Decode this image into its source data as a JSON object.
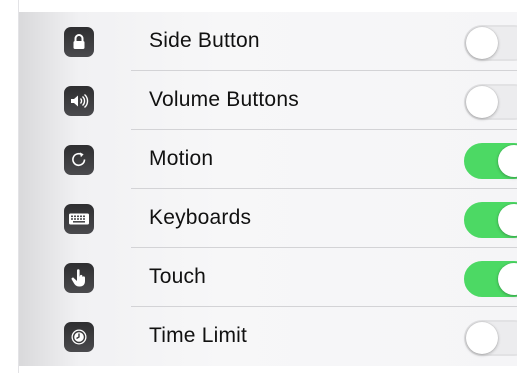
{
  "settings": {
    "items": [
      {
        "label": "Side Button",
        "icon": "lock-icon",
        "enabled": false
      },
      {
        "label": "Volume Buttons",
        "icon": "volume-icon",
        "enabled": false
      },
      {
        "label": "Motion",
        "icon": "rotate-icon",
        "enabled": true
      },
      {
        "label": "Keyboards",
        "icon": "keyboard-icon",
        "enabled": true
      },
      {
        "label": "Touch",
        "icon": "touch-hand-icon",
        "enabled": true
      },
      {
        "label": "Time Limit",
        "icon": "timer-icon",
        "enabled": false
      }
    ]
  },
  "colors": {
    "toggle_on": "#4cd964",
    "toggle_off": "#ececee",
    "icon_background": "#3a3a3c"
  }
}
